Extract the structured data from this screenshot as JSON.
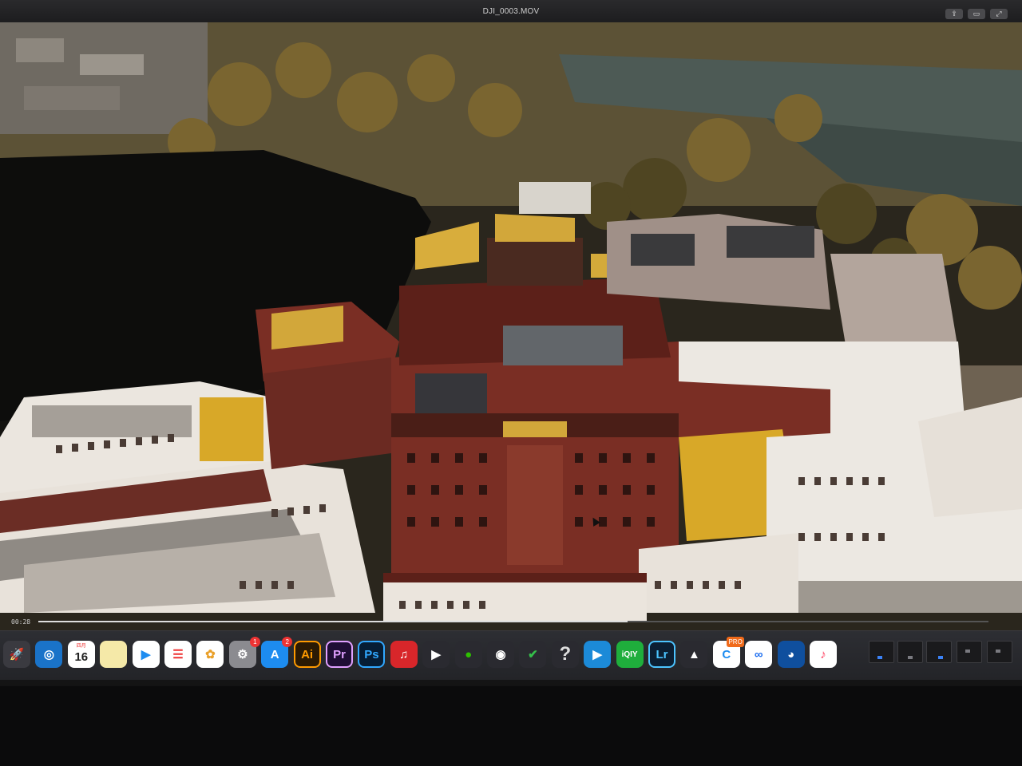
{
  "window": {
    "title": "DJI_0003.MOV"
  },
  "player": {
    "elapsed": "00:28",
    "progress": 0.62
  },
  "colors": {
    "wall_white": "#ece8e2",
    "wall_red": "#7a2e24",
    "roof_gold": "#d2a73a",
    "roof_dark": "#3a3a3c",
    "trees": "#6b5a2f",
    "water": "#4d5a55"
  },
  "dock": {
    "items": [
      {
        "name": "launchpad-icon",
        "label": ""
      },
      {
        "name": "safari-icon",
        "label": ""
      },
      {
        "name": "calendar-icon",
        "label": "16",
        "month": "四月"
      },
      {
        "name": "notes-icon",
        "label": ""
      },
      {
        "name": "video-player-icon",
        "label": ""
      },
      {
        "name": "reminders-icon",
        "label": ""
      },
      {
        "name": "photos-icon",
        "label": ""
      },
      {
        "name": "system-preferences-icon",
        "label": "",
        "badge": "1"
      },
      {
        "name": "app-store-icon",
        "label": "",
        "badge": "2"
      },
      {
        "name": "illustrator-icon",
        "label": "Ai"
      },
      {
        "name": "premiere-icon",
        "label": "Pr"
      },
      {
        "name": "photoshop-icon",
        "label": "Ps"
      },
      {
        "name": "netease-music-icon",
        "label": ""
      },
      {
        "name": "tencent-video-icon",
        "label": ""
      },
      {
        "name": "wechat-icon",
        "label": ""
      },
      {
        "name": "qq-icon",
        "label": ""
      },
      {
        "name": "checkmark-app-icon",
        "label": ""
      },
      {
        "name": "help-icon",
        "label": "?"
      },
      {
        "name": "youku-icon",
        "label": ""
      },
      {
        "name": "iqiyi-icon",
        "label": "iQIY"
      },
      {
        "name": "lightroom-icon",
        "label": "Lr"
      },
      {
        "name": "keynote-icon",
        "label": ""
      },
      {
        "name": "pro-app-icon",
        "label": "",
        "badge": "PRO"
      },
      {
        "name": "baidu-netdisk-icon",
        "label": ""
      },
      {
        "name": "browser-icon",
        "label": ""
      },
      {
        "name": "music-icon",
        "label": ""
      }
    ]
  }
}
